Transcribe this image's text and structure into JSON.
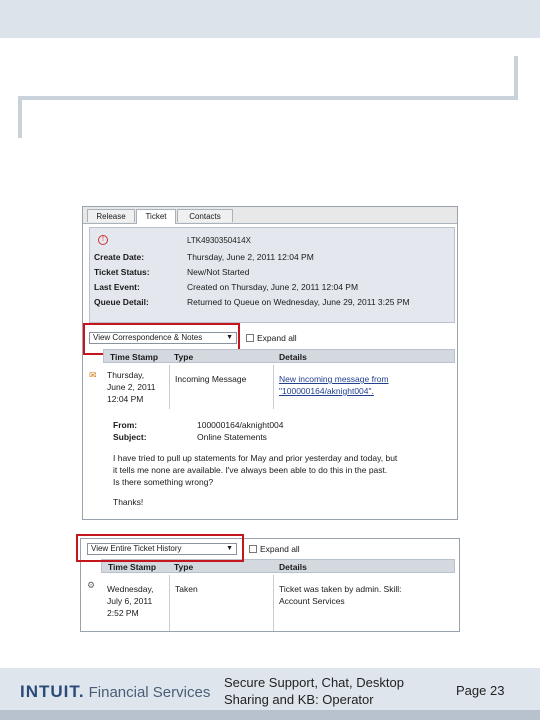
{
  "shot1": {
    "tabs": [
      "Release",
      "Ticket",
      "Contacts"
    ],
    "ticket_id": "LTK4930350414X",
    "fields": [
      {
        "label": "Create Date:",
        "value": "Thursday, June 2, 2011 12:04 PM"
      },
      {
        "label": "Ticket Status:",
        "value": "New/Not Started"
      },
      {
        "label": "Last Event:",
        "value": "Created on Thursday, June 2, 2011 12:04 PM"
      },
      {
        "label": "Queue Detail:",
        "value": "Returned to Queue on Wednesday, June 29, 2011 3:25 PM"
      }
    ],
    "dropdown": "View Correspondence & Notes",
    "expand_all": "Expand all",
    "columns": [
      "Time Stamp",
      "Type",
      "Details"
    ],
    "row": {
      "time": [
        "Thursday,",
        "June 2, 2011",
        "12:04 PM"
      ],
      "type": "Incoming Message",
      "details": [
        "New incoming message from",
        "\"100000164/aknight004\"."
      ]
    },
    "message": {
      "from_label": "From:",
      "from_value": "100000164/aknight004",
      "subject_label": "Subject:",
      "subject_value": "Online Statements",
      "body": [
        "I have tried to pull up statements for May and prior yesterday and today, but",
        "it tells me none are available. I've always been able to do this in the past.",
        "Is there something wrong?"
      ],
      "signoff": "Thanks!"
    }
  },
  "shot2": {
    "dropdown": "View Entire Ticket History",
    "expand_all": "Expand all",
    "columns": [
      "Time Stamp",
      "Type",
      "Details"
    ],
    "row": {
      "time": [
        "Wednesday,",
        "July 6, 2011",
        "2:52 PM"
      ],
      "type": "Taken",
      "details": [
        "Ticket was taken by admin. Skill:",
        "Account Services"
      ]
    }
  },
  "footer": {
    "brand": "INTUIT.",
    "brand_suffix": "Financial Services",
    "title": "Secure Support, Chat, Desktop Sharing and KB: Operator",
    "page": "Page 23"
  },
  "colors": {
    "highlight": "#c4161c",
    "header_bg": "#d4d9e0",
    "footer_bg": "#dfe5ec"
  }
}
